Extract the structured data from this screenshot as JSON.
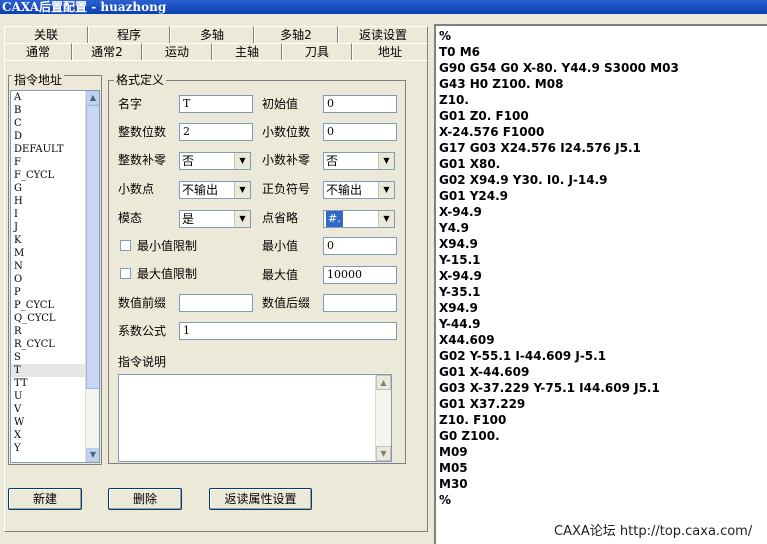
{
  "window": {
    "title": "CAXA后置配置 - huazhong"
  },
  "tabs_top": [
    "关联",
    "程序",
    "多轴",
    "多轴2",
    "返读设置"
  ],
  "tabs_bottom": [
    "通常",
    "通常2",
    "运动",
    "主轴",
    "刀具",
    "地址"
  ],
  "address_list": {
    "title": "指令地址",
    "items": [
      "A",
      "B",
      "C",
      "D",
      "DEFAULT",
      "F",
      "F_CYCL",
      "G",
      "H",
      "I",
      "J",
      "K",
      "M",
      "N",
      "O",
      "P",
      "P_CYCL",
      "Q_CYCL",
      "R",
      "R_CYCL",
      "S",
      "T",
      "TT",
      "U",
      "V",
      "W",
      "X",
      "Y"
    ],
    "selected": "T"
  },
  "format": {
    "title": "格式定义",
    "name_label": "名字",
    "name_value": "T",
    "init_label": "初始值",
    "init_value": "0",
    "int_digits_label": "整数位数",
    "int_digits_value": "2",
    "dec_digits_label": "小数位数",
    "dec_digits_value": "0",
    "int_pad_label": "整数补零",
    "int_pad_value": "否",
    "dec_pad_label": "小数补零",
    "dec_pad_value": "否",
    "decimal_point_label": "小数点",
    "decimal_point_value": "不输出",
    "plus_sign_label": "正负符号",
    "plus_sign_value": "不输出",
    "modal_label": "模态",
    "modal_value": "是",
    "point_omit_label": "点省略",
    "point_omit_value": "#.",
    "min_limit_label": "最小值限制",
    "min_value_label": "最小值",
    "min_value": "0",
    "max_limit_label": "最大值限制",
    "max_value_label": "最大值",
    "max_value": "10000",
    "prefix_label": "数值前缀",
    "prefix_value": "",
    "suffix_label": "数值后缀",
    "suffix_value": "",
    "coef_label": "系数公式",
    "coef_value": "1",
    "desc_label": "指令说明"
  },
  "buttons": {
    "new": "新建",
    "delete": "删除",
    "readback": "返读属性设置"
  },
  "code_lines": [
    "%",
    "T0 M6",
    "G90 G54 G0 X-80. Y44.9 S3000 M03",
    "G43 H0 Z100. M08",
    "Z10.",
    "G01 Z0. F100",
    "X-24.576 F1000",
    "G17 G03 X24.576 I24.576 J5.1",
    "G01 X80.",
    "G02 X94.9 Y30. I0. J-14.9",
    "G01 Y24.9",
    "X-94.9",
    "Y4.9",
    "X94.9",
    "Y-15.1",
    "X-94.9",
    "Y-35.1",
    "X94.9",
    "Y-44.9",
    "X44.609",
    "G02 Y-55.1 I-44.609 J-5.1",
    "G01 X-44.609",
    "G03 X-37.229 Y-75.1 I44.609 J5.1",
    "G01 X37.229",
    "Z10. F100",
    "G0 Z100.",
    "M09",
    "M05",
    "M30",
    "%"
  ],
  "watermark": "CAXA论坛 http://top.caxa.com/"
}
